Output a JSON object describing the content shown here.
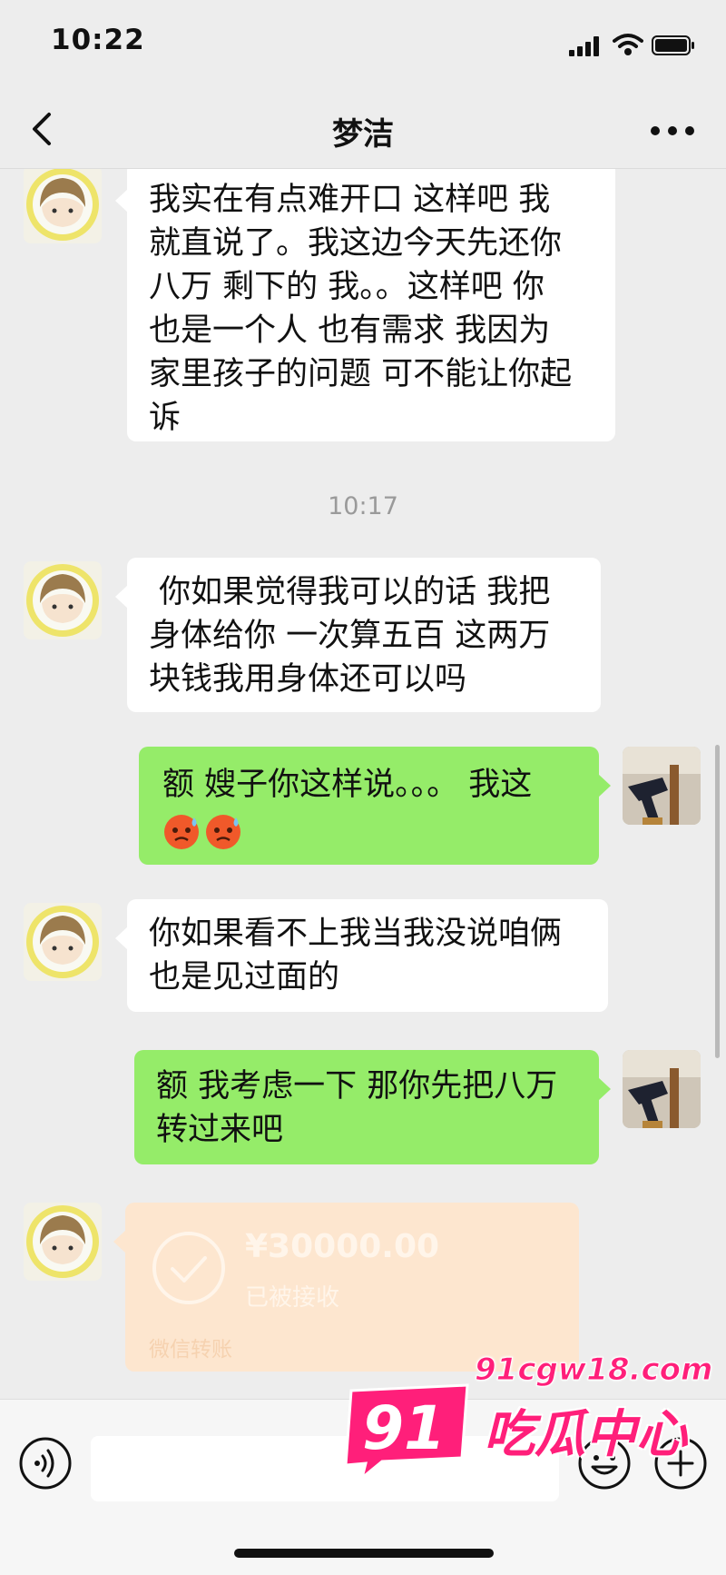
{
  "status_bar": {
    "time": "10:22",
    "signal_icon": "signal-bars-icon",
    "wifi_icon": "wifi-icon",
    "battery_icon": "battery-icon"
  },
  "nav": {
    "back_icon": "chevron-left-icon",
    "title": "梦洁",
    "more_icon": "more-dots-icon"
  },
  "messages": [
    {
      "side": "left",
      "sender": "梦洁",
      "text": "我实在有点难开口 这样吧 我\n就直说了。我这边今天先还你\n八万 剩下的 我。。这样吧 你\n也是一个人 也有需求 我因为\n家里孩子的问题 可不能让你起\n诉"
    },
    {
      "timestamp": "10:17"
    },
    {
      "side": "left",
      "sender": "梦洁",
      "text": " 你如果觉得我可以的话 我把\n身体给你 一次算五百 这两万\n块钱我用身体还可以吗"
    },
    {
      "side": "right",
      "sender": "me",
      "text": "额 嫂子你这样说。。。 我这",
      "emojis": [
        "sweat-face-emoji",
        "sweat-face-emoji"
      ]
    },
    {
      "side": "left",
      "sender": "梦洁",
      "text": "你如果看不上我当我没说咱俩\n也是见过面的"
    },
    {
      "side": "right",
      "sender": "me",
      "text": "额 我考虑一下 那你先把八万\n转过来吧"
    }
  ],
  "transfer": {
    "amount": "¥30000.00",
    "status": "已被接收",
    "label": "微信转账",
    "icon": "check-circle-icon"
  },
  "input_bar": {
    "voice_icon": "voice-icon",
    "input_value": "",
    "emoji_icon": "emoji-icon",
    "plus_icon": "plus-circle-icon"
  },
  "watermark": {
    "badge": "91",
    "url": "91cgw18.com",
    "name": "吃瓜中心"
  },
  "colors": {
    "chat_bg": "#ededed",
    "sent_bubble": "#95ec69",
    "received_bubble": "#ffffff",
    "transfer_card": "#fde6cf",
    "watermark": "#ff1f7a"
  }
}
